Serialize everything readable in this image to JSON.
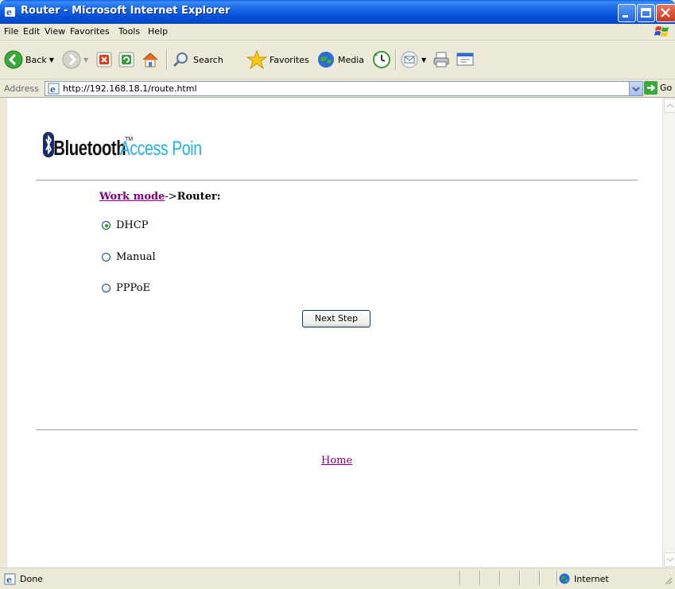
{
  "window": {
    "title": "Router - Microsoft Internet Explorer",
    "controls": [
      "minimize",
      "maximize",
      "close"
    ]
  },
  "menu": [
    "File",
    "Edit",
    "View",
    "Favorites",
    "Tools",
    "Help"
  ],
  "toolbar": {
    "back": "Back",
    "search": "Search",
    "favorites": "Favorites",
    "media": "Media"
  },
  "address": {
    "label": "Address",
    "url": "http://192.168.18.1/route.html",
    "go": "Go"
  },
  "page": {
    "logo_text": "Bluetooth Access Point",
    "breadcrumb": {
      "link": "Work mode",
      "arrow": "->",
      "current": "Router:"
    },
    "options": [
      {
        "label": "DHCP",
        "selected": true
      },
      {
        "label": "Manual",
        "selected": false
      },
      {
        "label": "PPPoE",
        "selected": false
      }
    ],
    "next_button": "Next Step",
    "home_link": "Home"
  },
  "status": {
    "text": "Done",
    "zone": "Internet"
  },
  "colors": {
    "titlebar": "#0550d8",
    "visited_link": "#800080",
    "radio_selected": "#21a121"
  }
}
